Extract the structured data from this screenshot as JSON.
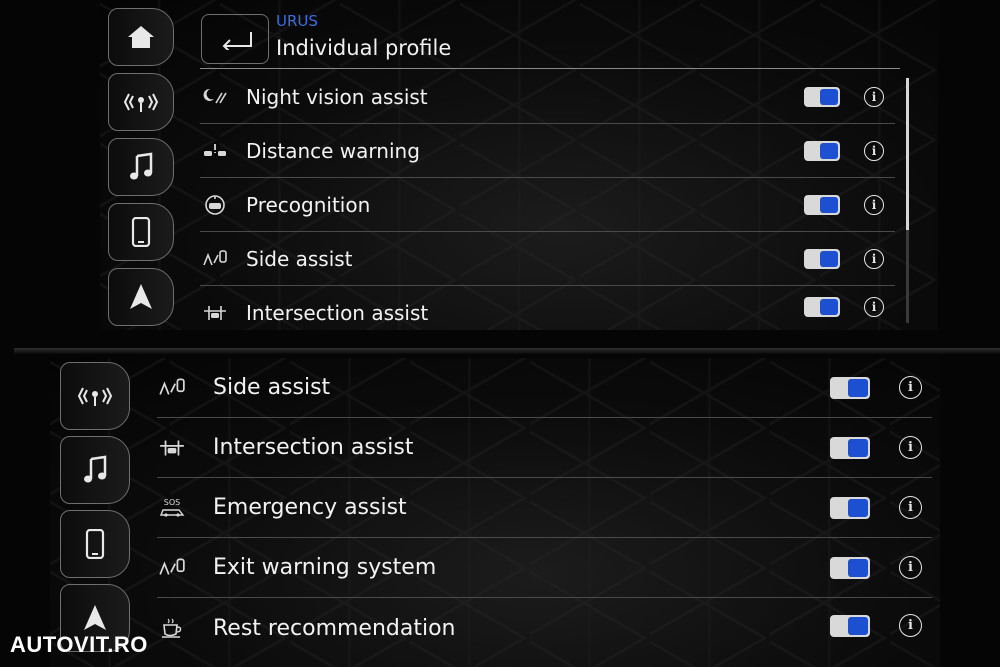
{
  "top_screen": {
    "header": {
      "subtitle": "URUS",
      "title": "Individual profile"
    },
    "sidebar": [
      {
        "icon": "home-icon"
      },
      {
        "icon": "car-signal-icon"
      },
      {
        "icon": "music-note-icon"
      },
      {
        "icon": "phone-icon"
      },
      {
        "icon": "navigation-arrow-icon"
      }
    ],
    "rows": [
      {
        "label": "Night vision assist",
        "icon": "night-vision-icon",
        "enabled": true
      },
      {
        "label": "Distance warning",
        "icon": "distance-warning-icon",
        "enabled": true
      },
      {
        "label": "Precognition",
        "icon": "precognition-icon",
        "enabled": true
      },
      {
        "label": "Side assist",
        "icon": "side-assist-icon",
        "enabled": true
      },
      {
        "label": "Intersection assist",
        "icon": "intersection-assist-icon",
        "enabled": true
      }
    ]
  },
  "bottom_screen": {
    "sidebar": [
      {
        "icon": "car-signal-icon"
      },
      {
        "icon": "music-note-icon"
      },
      {
        "icon": "phone-icon"
      },
      {
        "icon": "navigation-arrow-icon"
      }
    ],
    "rows": [
      {
        "label": "Side assist",
        "icon": "side-assist-icon",
        "enabled": true
      },
      {
        "label": "Intersection assist",
        "icon": "intersection-assist-icon",
        "enabled": true
      },
      {
        "label": "Emergency assist",
        "icon": "sos-car-icon",
        "icon_text": "SOS",
        "enabled": true
      },
      {
        "label": "Exit warning system",
        "icon": "exit-warning-icon",
        "enabled": true
      },
      {
        "label": "Rest recommendation",
        "icon": "coffee-cup-icon",
        "enabled": true
      }
    ]
  },
  "colors": {
    "accent": "#1d4fd1",
    "subtitle": "#3b6fe0",
    "divider": "#4a4a4a"
  },
  "watermark": "AUTOVIT.RO"
}
